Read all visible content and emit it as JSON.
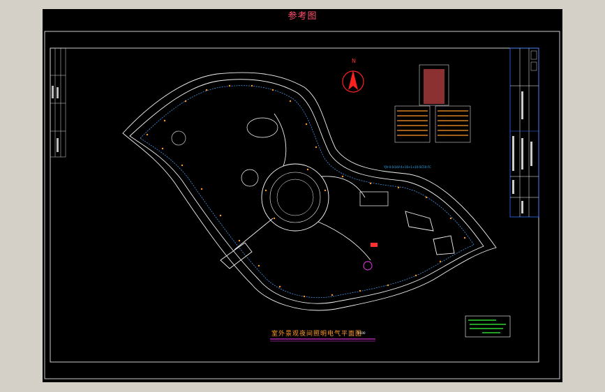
{
  "sheet": {
    "reference_title": "参考图",
    "drawing_title": "室外景观夜间照明电气平面图",
    "scale_note": "1:500",
    "north_label": "N",
    "cable_callout": "YJV-0.6/1kV-4×16+1×10-SC50-FC"
  },
  "colors": {
    "background": "#000000",
    "reference_title": "#ff4f6a",
    "drawing_title": "#ff9a2a",
    "north_arrow": "#ff2020",
    "linework": "#ffffff",
    "cable": "#4da6ff",
    "legend": "#3aff3a"
  },
  "icons": [
    "north-arrow-icon",
    "lamp-icon",
    "distribution-box-icon"
  ]
}
